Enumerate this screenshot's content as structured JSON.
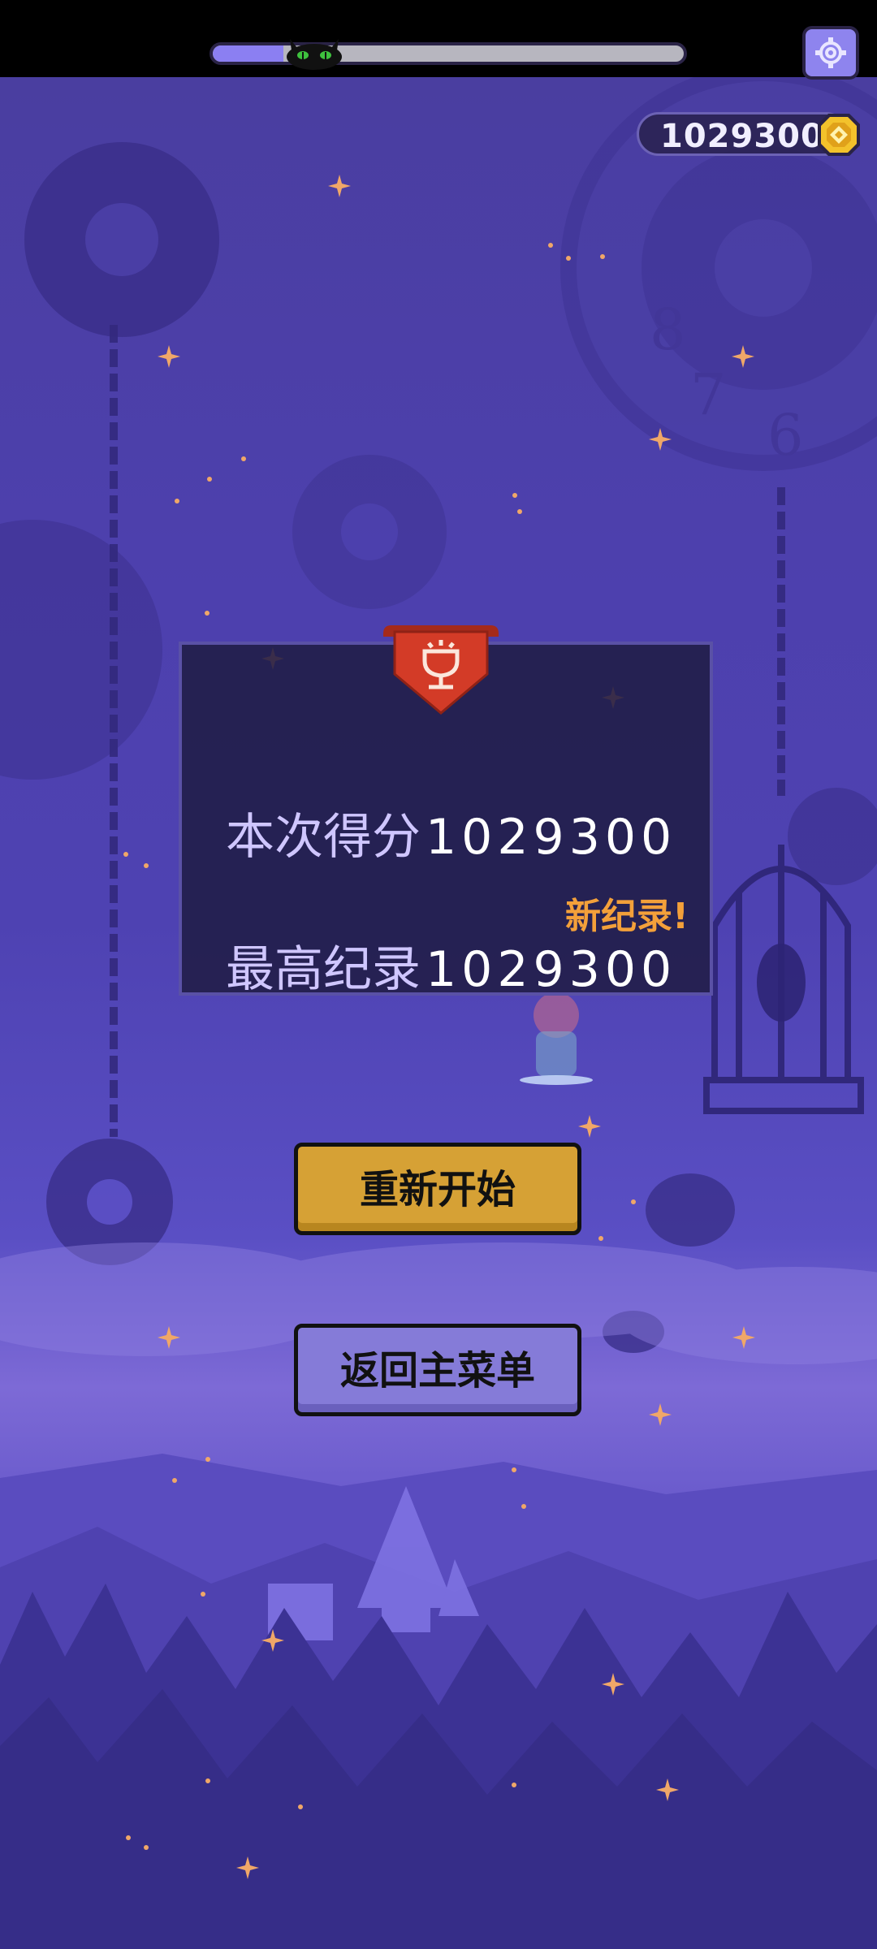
{
  "hud": {
    "level_progress": 0.15,
    "progress_marker_icon": "black-cat-icon",
    "settings_icon": "gear-icon",
    "coins": "1029300",
    "coin_icon": "gold-coin-icon"
  },
  "result": {
    "ribbon_icon": "trophy-icon",
    "current_score_label": "本次得分",
    "current_score": "1029300",
    "new_record_label": "新纪录!",
    "best_score_label": "最高纪录",
    "best_score": "1029300"
  },
  "buttons": {
    "restart": "重新开始",
    "main_menu": "返回主菜单"
  },
  "colors": {
    "background": "#4e42b2",
    "progress_fill": "#8b7ff2",
    "restart_button": "#d6a135",
    "menu_button": "#857bd8",
    "new_record": "#f3a03a",
    "ribbon": "#d33b27"
  }
}
